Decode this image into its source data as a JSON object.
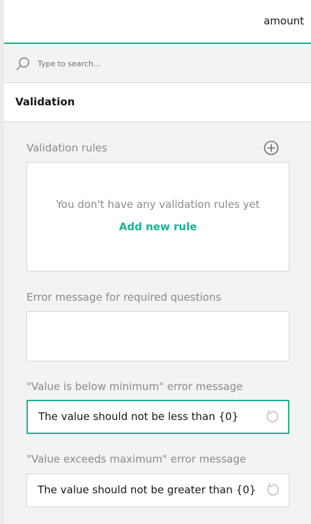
{
  "header": {
    "title": "amount"
  },
  "search": {
    "placeholder": "Type to search..."
  },
  "section": {
    "title": "Validation"
  },
  "validation_rules": {
    "label": "Validation rules",
    "empty_text": "You don't have any validation rules yet",
    "add_link": "Add new rule"
  },
  "required_error": {
    "label": "Error message for required questions",
    "value": ""
  },
  "min_error": {
    "label": "\"Value is below minimum\" error message",
    "value": "The value should not be less than {0}"
  },
  "max_error": {
    "label": "\"Value exceeds maximum\" error message",
    "value": "The value should not be greater than {0}"
  },
  "colors": {
    "accent": "#19b394",
    "border": "#d6d6d6",
    "muted_text": "#8a8a8a",
    "background": "#f3f3f3"
  },
  "icons": {
    "search": "search-icon",
    "add": "plus-circle-icon",
    "reset": "reset-icon"
  }
}
